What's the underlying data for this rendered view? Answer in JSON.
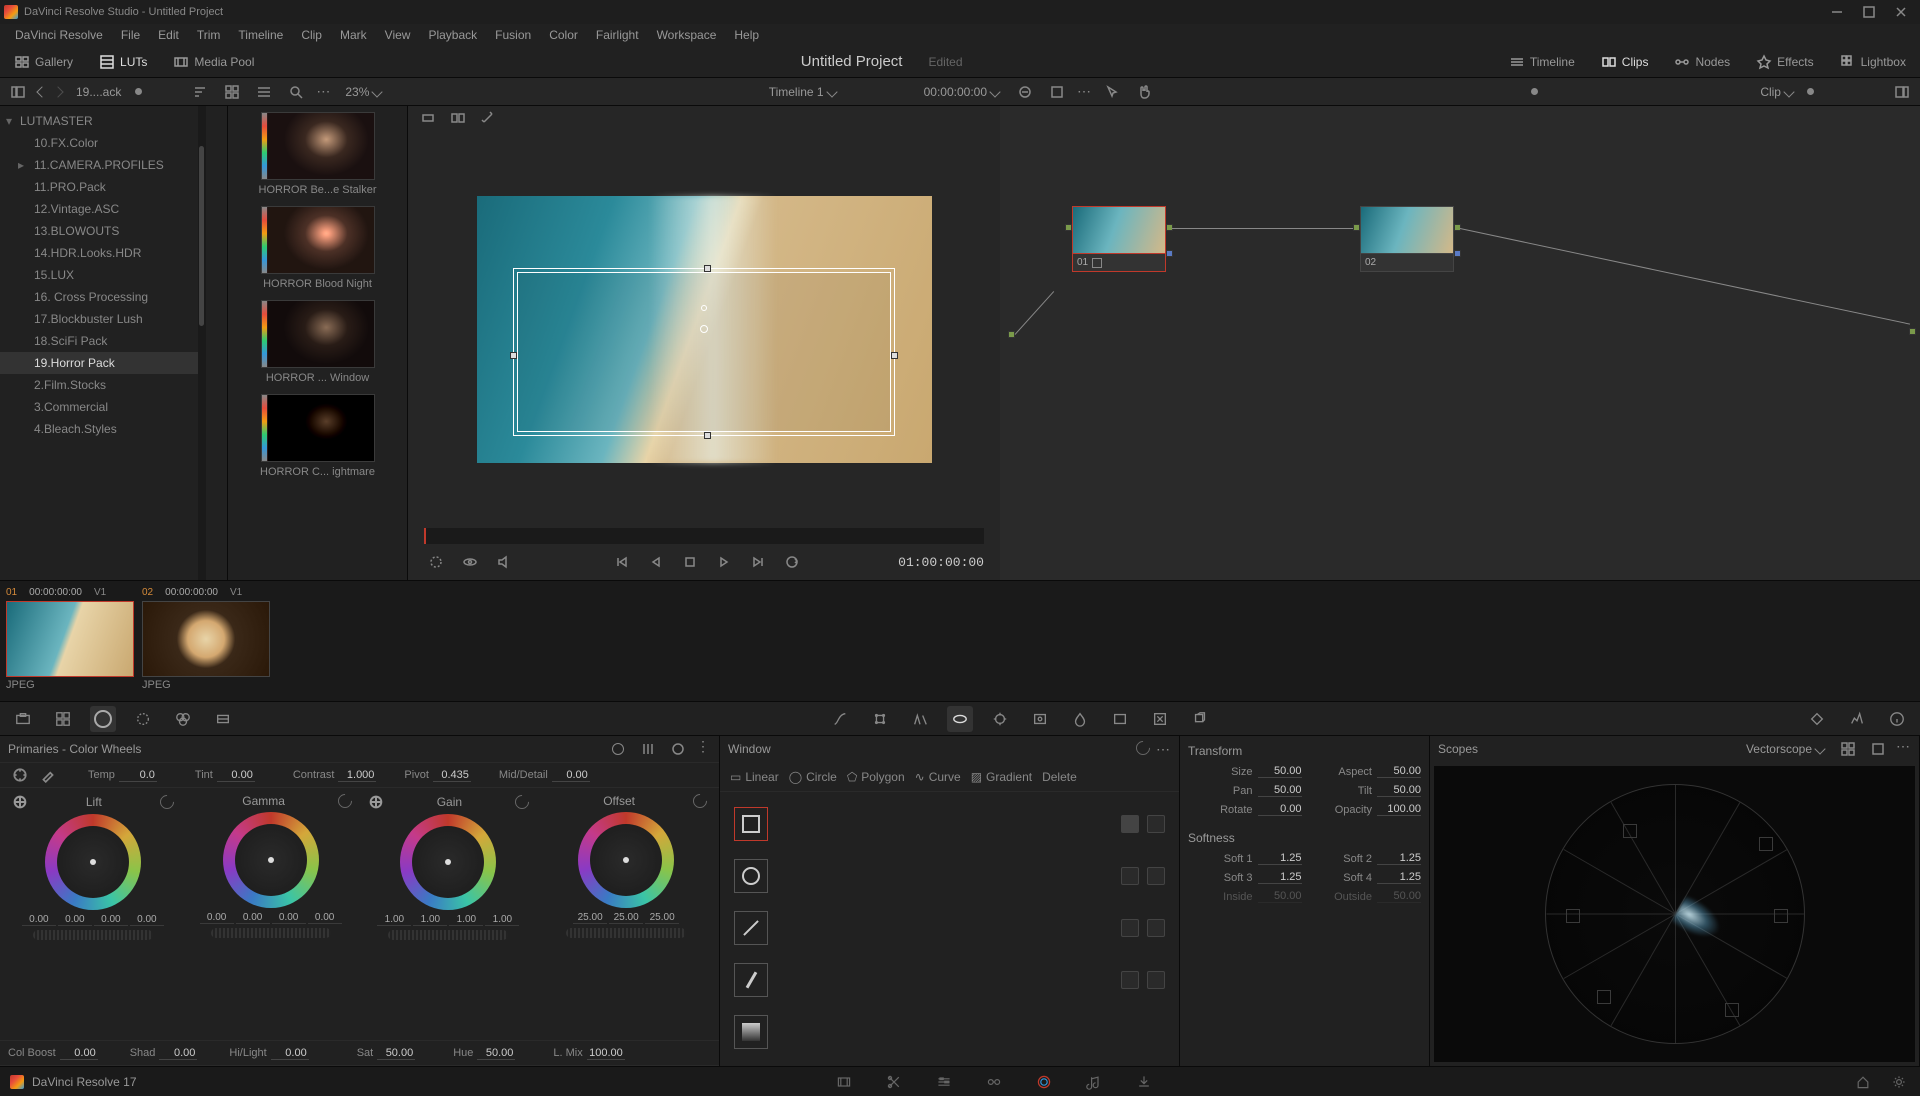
{
  "app": {
    "title": "DaVinci Resolve Studio - Untitled Project",
    "version": "DaVinci Resolve 17"
  },
  "menu": [
    "DaVinci Resolve",
    "File",
    "Edit",
    "Trim",
    "Timeline",
    "Clip",
    "Mark",
    "View",
    "Playback",
    "Fusion",
    "Color",
    "Fairlight",
    "Workspace",
    "Help"
  ],
  "toolbar": {
    "gallery": "Gallery",
    "luts": "LUTs",
    "mediapool": "Media Pool",
    "project": "Untitled Project",
    "edited": "Edited",
    "timeline": "Timeline",
    "clips": "Clips",
    "nodes": "Nodes",
    "effects": "Effects",
    "lightbox": "Lightbox"
  },
  "subbar": {
    "path": "19....ack",
    "zoom": "23%",
    "timeline": "Timeline 1",
    "tc": "00:00:00:00",
    "clip": "Clip"
  },
  "tree": {
    "root": "LUTMASTER",
    "items": [
      {
        "l": "10.FX.Color"
      },
      {
        "l": "11.CAMERA.PROFILES",
        "exp": true
      },
      {
        "l": "11.PRO.Pack"
      },
      {
        "l": "12.Vintage.ASC"
      },
      {
        "l": "13.BLOWOUTS"
      },
      {
        "l": "14.HDR.Looks.HDR"
      },
      {
        "l": "15.LUX"
      },
      {
        "l": "16. Cross Processing"
      },
      {
        "l": "17.Blockbuster Lush"
      },
      {
        "l": "18.SciFi Pack"
      },
      {
        "l": "19.Horror Pack",
        "sel": true
      },
      {
        "l": "2.Film.Stocks"
      },
      {
        "l": "3.Commercial"
      },
      {
        "l": "4.Bleach.Styles"
      }
    ]
  },
  "luts": [
    {
      "l": "HORROR Be...e Stalker"
    },
    {
      "l": "HORROR Blood Night"
    },
    {
      "l": "HORROR ... Window"
    },
    {
      "l": "HORROR C... ightmare"
    }
  ],
  "transport": {
    "tc": "01:00:00:00"
  },
  "nodes": [
    {
      "id": "01"
    },
    {
      "id": "02"
    }
  ],
  "clips": [
    {
      "n": "01",
      "tc": "00:00:00:00",
      "trk": "V1",
      "type": "JPEG",
      "cls": "beach",
      "sel": true
    },
    {
      "n": "02",
      "tc": "00:00:00:00",
      "trk": "V1",
      "type": "JPEG",
      "cls": "coffee"
    }
  ],
  "primaries": {
    "title": "Primaries - Color Wheels",
    "temp": {
      "l": "Temp",
      "v": "0.0"
    },
    "tint": {
      "l": "Tint",
      "v": "0.00"
    },
    "contrast": {
      "l": "Contrast",
      "v": "1.000"
    },
    "pivot": {
      "l": "Pivot",
      "v": "0.435"
    },
    "md": {
      "l": "Mid/Detail",
      "v": "0.00"
    },
    "wheels": [
      {
        "l": "Lift",
        "v": [
          "0.00",
          "0.00",
          "0.00",
          "0.00"
        ]
      },
      {
        "l": "Gamma",
        "v": [
          "0.00",
          "0.00",
          "0.00",
          "0.00"
        ]
      },
      {
        "l": "Gain",
        "v": [
          "1.00",
          "1.00",
          "1.00",
          "1.00"
        ]
      },
      {
        "l": "Offset",
        "v": [
          "25.00",
          "25.00",
          "25.00"
        ]
      }
    ],
    "colboost": {
      "l": "Col Boost",
      "v": "0.00"
    },
    "shad": {
      "l": "Shad",
      "v": "0.00"
    },
    "hilight": {
      "l": "Hi/Light",
      "v": "0.00"
    },
    "sat": {
      "l": "Sat",
      "v": "50.00"
    },
    "hue": {
      "l": "Hue",
      "v": "50.00"
    },
    "lmix": {
      "l": "L. Mix",
      "v": "100.00"
    }
  },
  "window": {
    "title": "Window",
    "shapes": [
      "Linear",
      "Circle",
      "Polygon",
      "Curve",
      "Gradient"
    ],
    "delete": "Delete"
  },
  "transform": {
    "title": "Transform",
    "size": {
      "l": "Size",
      "v": "50.00"
    },
    "aspect": {
      "l": "Aspect",
      "v": "50.00"
    },
    "pan": {
      "l": "Pan",
      "v": "50.00"
    },
    "tilt": {
      "l": "Tilt",
      "v": "50.00"
    },
    "rotate": {
      "l": "Rotate",
      "v": "0.00"
    },
    "opacity": {
      "l": "Opacity",
      "v": "100.00"
    },
    "soft": "Softness",
    "s1": {
      "l": "Soft 1",
      "v": "1.25"
    },
    "s2": {
      "l": "Soft 2",
      "v": "1.25"
    },
    "s3": {
      "l": "Soft 3",
      "v": "1.25"
    },
    "s4": {
      "l": "Soft 4",
      "v": "1.25"
    },
    "inside": {
      "l": "Inside",
      "v": "50.00"
    },
    "outside": {
      "l": "Outside",
      "v": "50.00"
    }
  },
  "scopes": {
    "title": "Scopes",
    "mode": "Vectorscope"
  }
}
